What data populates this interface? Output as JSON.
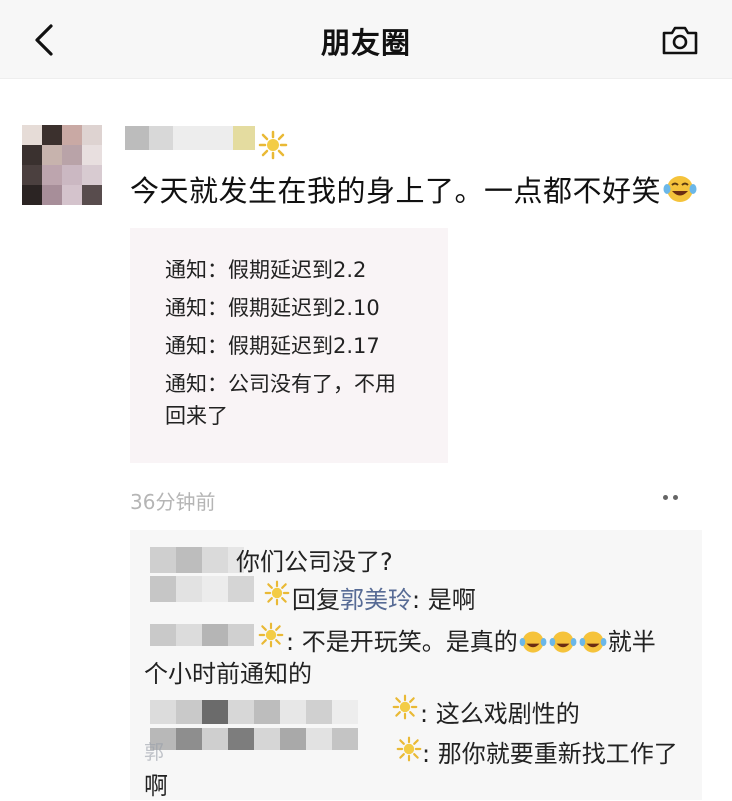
{
  "header": {
    "title": "朋友圈",
    "back_icon": "back-arrow-icon",
    "camera_icon": "camera-icon"
  },
  "post": {
    "text": "今天就发生在我的身上了。一点都不好笑",
    "notice_lines": [
      "通知：假期延迟到2.2",
      "通知：假期延迟到2.10",
      "通知：假期延迟到2.17",
      "通知：公司没有了，不用",
      "回来了"
    ],
    "time": "36分钟前"
  },
  "comments": {
    "c1": "你们公司没了?",
    "c2_prefix": "回复",
    "c2_name": "郭美玲",
    "c2_suffix": ": 是啊",
    "c3_a": ": 不是开玩笑。是真的",
    "c3_b": "就半",
    "c3_line2": "个小时前通知的",
    "c4": ": 这么戏剧性的",
    "c5": ": 那你就要重新找工作了",
    "c5_line2": "啊",
    "c5_name_fragment": "郭"
  },
  "colors": {
    "link": "#576b95",
    "time": "#b5b5b5",
    "card_bg": "#f9f4f6",
    "comments_bg": "#f7f7f7"
  }
}
